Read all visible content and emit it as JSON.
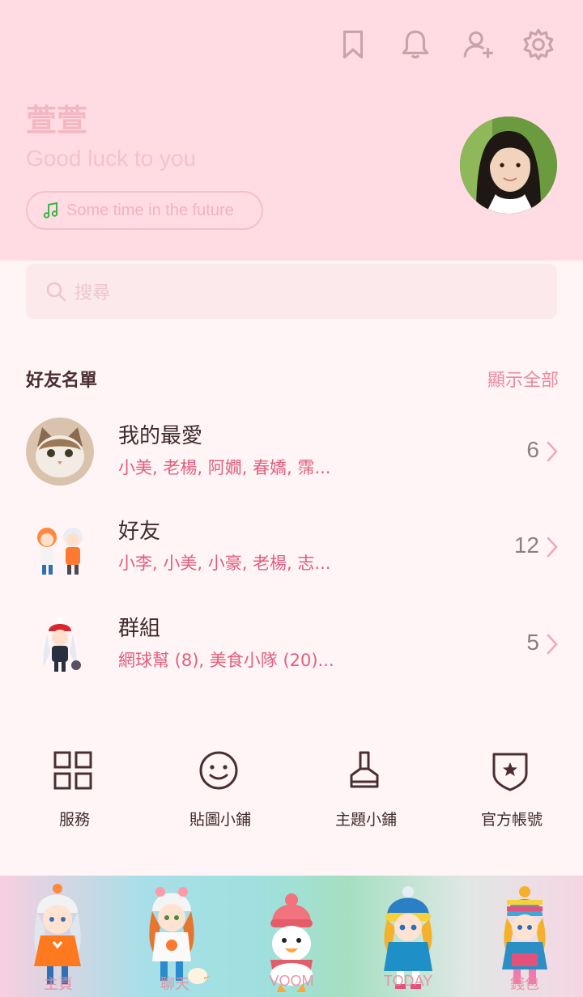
{
  "header": {
    "icons": [
      "bookmark-icon",
      "bell-icon",
      "add-friend-icon",
      "gear-icon"
    ],
    "profile_name": "萱萱",
    "status_message": "Good luck to you",
    "music_label": "Some time in the future"
  },
  "search": {
    "placeholder": "搜尋"
  },
  "friends": {
    "section_title": "好友名單",
    "show_all": "顯示全部",
    "rows": [
      {
        "title": "我的最愛",
        "subtitle": "小美, 老楊, 阿嫺, 春嬌, 霈...",
        "count": "6"
      },
      {
        "title": "好友",
        "subtitle": "小李, 小美, 小豪, 老楊, 志...",
        "count": "12"
      },
      {
        "title": "群組",
        "subtitle": "網球幫 (8), 美食小隊 (20)...",
        "count": "5"
      }
    ]
  },
  "shortcuts": [
    {
      "label": "服務",
      "icon": "grid-icon"
    },
    {
      "label": "貼圖小鋪",
      "icon": "smiley-icon"
    },
    {
      "label": "主題小鋪",
      "icon": "brush-icon"
    },
    {
      "label": "官方帳號",
      "icon": "shield-star-icon"
    }
  ],
  "tabbar": {
    "tabs": [
      {
        "label": "主頁"
      },
      {
        "label": "聊天"
      },
      {
        "label": "VOOM"
      },
      {
        "label": "TODAY"
      },
      {
        "label": "錢包"
      }
    ]
  },
  "colors": {
    "header_bg": "#ffdce3",
    "page_bg": "#fff5f6",
    "accent": "#e15f7d",
    "icon": "#c9a2aa"
  }
}
